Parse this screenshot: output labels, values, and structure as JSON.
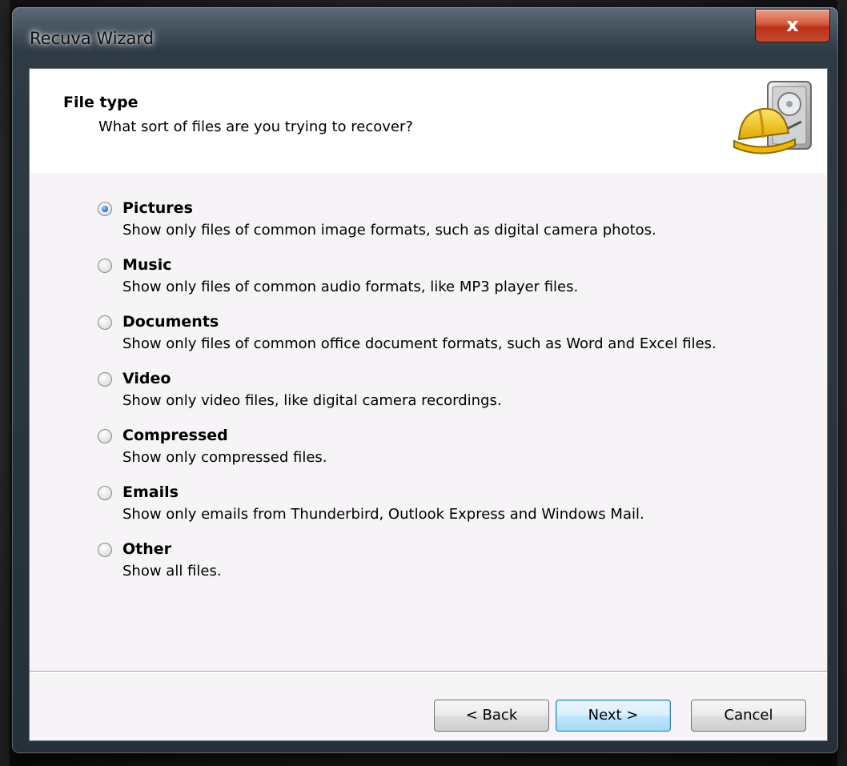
{
  "window": {
    "title": "Recuva Wizard",
    "close_glyph": "x"
  },
  "header": {
    "title": "File type",
    "subtitle": "What sort of files are you trying to recover?",
    "icon": "hard-drive-with-hardhat-icon"
  },
  "options": [
    {
      "label": "Pictures",
      "description": "Show only files of common image formats, such as digital camera photos.",
      "selected": true
    },
    {
      "label": "Music",
      "description": "Show only files of common audio formats, like MP3 player files.",
      "selected": false
    },
    {
      "label": "Documents",
      "description": "Show only files of common office document formats, such as Word and Excel files.",
      "selected": false
    },
    {
      "label": "Video",
      "description": "Show only video files, like digital camera recordings.",
      "selected": false
    },
    {
      "label": "Compressed",
      "description": "Show only compressed files.",
      "selected": false
    },
    {
      "label": "Emails",
      "description": "Show only emails from Thunderbird, Outlook Express and Windows Mail.",
      "selected": false
    },
    {
      "label": "Other",
      "description": "Show all files.",
      "selected": false
    }
  ],
  "buttons": {
    "back": "< Back",
    "next": "Next >",
    "cancel": "Cancel"
  },
  "colors": {
    "radio_selected": "#2f7fd8",
    "close_button": "#c8482a",
    "default_button_border": "#3c7fb1"
  }
}
